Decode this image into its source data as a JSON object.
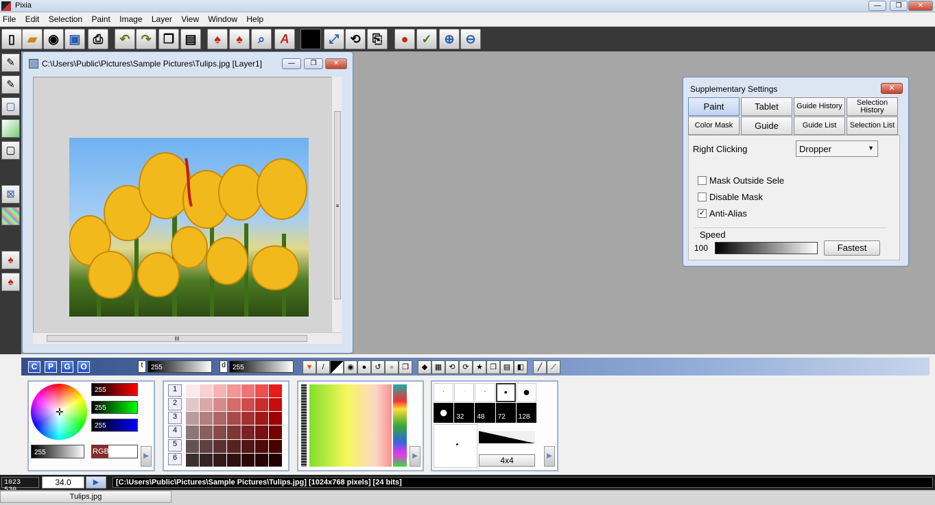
{
  "app": {
    "title": "Pixia"
  },
  "menu": [
    "File",
    "Edit",
    "Selection",
    "Paint",
    "Image",
    "Layer",
    "View",
    "Window",
    "Help"
  ],
  "window_controls": {
    "minimize": "—",
    "restore": "❐",
    "close": "✕"
  },
  "image_window": {
    "title": "C:\\Users\\Public\\Pictures\\Sample Pictures\\Tulips.jpg [Layer1]",
    "scroll_grip": "III",
    "vscroll_grip": "≡"
  },
  "supplementary": {
    "title": "Supplementary Settings",
    "tabs": [
      {
        "label": "Paint",
        "active": true
      },
      {
        "label": "Tablet",
        "active": false
      },
      {
        "label": "Guide History",
        "active": false
      },
      {
        "label": "Selection History",
        "active": false
      },
      {
        "label": "Color Mask",
        "active": false
      },
      {
        "label": "Guide",
        "active": false
      },
      {
        "label": "Guide List",
        "active": false
      },
      {
        "label": "Selection List",
        "active": false
      }
    ],
    "right_clicking_label": "Right Clicking",
    "right_clicking_value": "Dropper",
    "checkboxes": [
      {
        "label": "Mask Outside Sele",
        "checked": false
      },
      {
        "label": "Disable Mask",
        "checked": false
      },
      {
        "label": "Anti-Alias",
        "checked": true
      }
    ],
    "speed_label": "Speed",
    "speed_value": "100",
    "fastest_button": "Fastest"
  },
  "palette_bar": {
    "mode_buttons": [
      "C",
      "P",
      "G",
      "O"
    ],
    "t_label": "t",
    "t_value": "255",
    "d_label": "d",
    "d_value": "255"
  },
  "color_panel": {
    "r_value": "255",
    "g_value": "255",
    "b_value": "255",
    "gray_value": "255",
    "mode": "RGB",
    "arrow": "▶"
  },
  "swatch_panel": {
    "rows": [
      "1",
      "2",
      "3",
      "4",
      "5",
      "6"
    ]
  },
  "brush_panel": {
    "sizes": [
      "32",
      "48",
      "72",
      "128"
    ],
    "brush_size": "4x4"
  },
  "status": {
    "coords": "1023  530",
    "zoom": "34.0",
    "info": "[C:\\Users\\Public\\Pictures\\Sample Pictures\\Tulips.jpg] [1024x768 pixels] [24 bits]"
  },
  "taskbar": {
    "tab": "Tulips.jpg"
  },
  "colors": {
    "accent": "#6a88b4",
    "toolbar_bg": "#383838",
    "workspace": "#a6a6a6"
  }
}
